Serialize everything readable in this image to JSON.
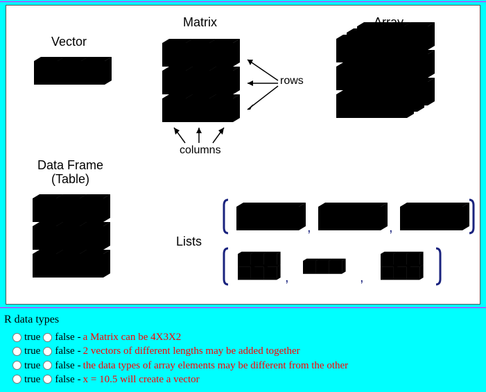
{
  "labels": {
    "vector": "Vector",
    "matrix": "Matrix",
    "array": "Array",
    "dataframe1": "Data Frame",
    "dataframe2": "(Table)",
    "lists": "Lists",
    "rows": "rows",
    "columns": "columns"
  },
  "quiz": {
    "title": "R data types",
    "true_label": "true",
    "false_label": "false",
    "dash": " - ",
    "q1": "a Matrix can be 4X3X2",
    "q2": "2 vectors of different lengths may be added together",
    "q3": "the data types of array elements may be different from the other",
    "q4": "x = 10.5 will create a vector"
  }
}
